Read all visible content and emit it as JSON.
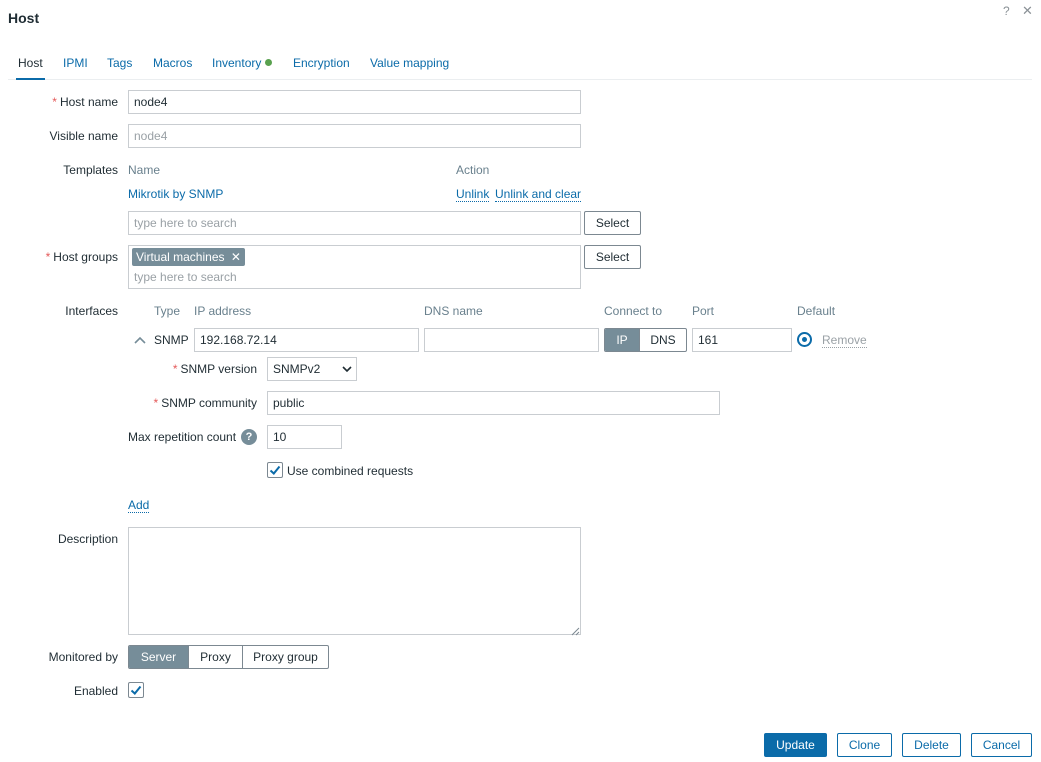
{
  "dialog": {
    "title": "Host",
    "help_glyph": "?",
    "close_glyph": "✕"
  },
  "tabs": [
    {
      "label": "Host",
      "active": true
    },
    {
      "label": "IPMI"
    },
    {
      "label": "Tags"
    },
    {
      "label": "Macros"
    },
    {
      "label": "Inventory"
    },
    {
      "label": "Encryption"
    },
    {
      "label": "Value mapping"
    }
  ],
  "form": {
    "host_name": {
      "label": "Host name",
      "value": "node4"
    },
    "visible_name": {
      "label": "Visible name",
      "placeholder": "node4"
    },
    "templates": {
      "label": "Templates",
      "col_name": "Name",
      "col_action": "Action",
      "rows": [
        {
          "name": "Mikrotik by SNMP",
          "unlink": "Unlink",
          "unlink_clear": "Unlink and clear"
        }
      ],
      "search_placeholder": "type here to search",
      "select_label": "Select"
    },
    "host_groups": {
      "label": "Host groups",
      "tags": [
        "Virtual machines"
      ],
      "search_placeholder": "type here to search",
      "select_label": "Select"
    },
    "interfaces": {
      "label": "Interfaces",
      "headers": {
        "type": "Type",
        "ip": "IP address",
        "dns": "DNS name",
        "connect": "Connect to",
        "port": "Port",
        "default": "Default"
      },
      "row": {
        "type": "SNMP",
        "ip": "192.168.72.14",
        "dns": "",
        "connect_ip": "IP",
        "connect_dns": "DNS",
        "port": "161",
        "remove": "Remove"
      },
      "snmp_version": {
        "label": "SNMP version",
        "value": "SNMPv2"
      },
      "snmp_community": {
        "label": "SNMP community",
        "value": "public"
      },
      "max_repetition": {
        "label": "Max repetition count",
        "value": "10"
      },
      "combined": {
        "label": "Use combined requests",
        "checked": true
      },
      "add_label": "Add"
    },
    "description": {
      "label": "Description",
      "value": ""
    },
    "monitored_by": {
      "label": "Monitored by",
      "options": [
        "Server",
        "Proxy",
        "Proxy group"
      ],
      "selected": "Server"
    },
    "enabled": {
      "label": "Enabled",
      "checked": true
    }
  },
  "footer": {
    "update": "Update",
    "clone": "Clone",
    "delete": "Delete",
    "cancel": "Cancel"
  },
  "colors": {
    "accent": "#0b6ba9",
    "required": "#e45959",
    "selected_segment": "#768d99",
    "inventory_dot": "#59a14f"
  }
}
